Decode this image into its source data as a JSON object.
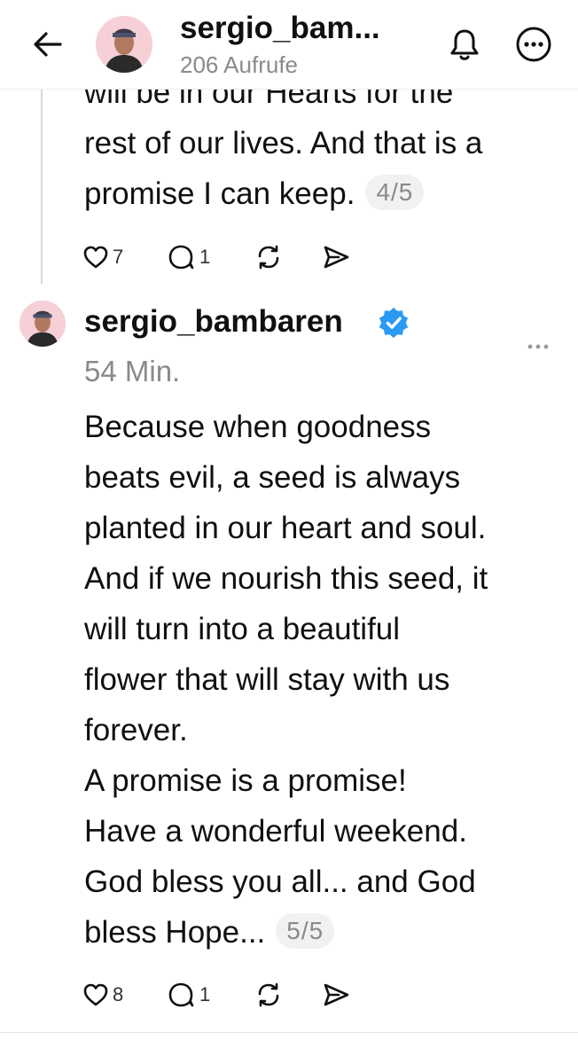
{
  "header": {
    "username": "sergio_bam...",
    "views": "206 Aufrufe"
  },
  "post1": {
    "text_partial": "will be in our Hearts for the",
    "text": "rest of our lives. And that is a\npromise I can keep.",
    "pager": "4/5",
    "likes": "7",
    "replies": "1"
  },
  "post2": {
    "username": "sergio_bambaren",
    "time": "54 Min.",
    "text": "Because when goodness\nbeats evil, a seed is always\nplanted in our heart and soul.\nAnd if we nourish this seed, it\nwill turn into a beautiful\nflower that will stay with us\nforever.\nA promise is a promise!\nHave a wonderful weekend.\nGod bless you all... and God\nbless Hope...",
    "pager": "5/5",
    "likes": "8",
    "replies": "1"
  },
  "colors": {
    "verified": "#2a9af3",
    "muted": "#8a8a8a",
    "text": "#101010"
  },
  "icons": [
    "back-arrow-icon",
    "bell-icon",
    "more-icon",
    "heart-icon",
    "reply-icon",
    "repost-icon",
    "share-icon",
    "verified-icon"
  ]
}
